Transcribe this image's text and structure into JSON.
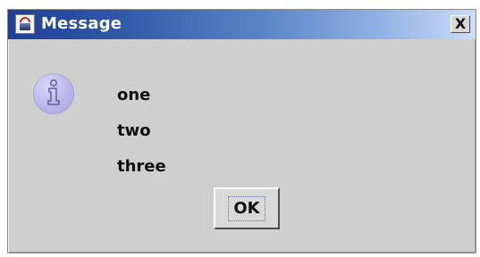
{
  "window": {
    "title": "Message",
    "close_glyph": "X"
  },
  "dialog": {
    "message_lines": [
      "one",
      "two",
      "three"
    ],
    "ok_label": "OK"
  },
  "icons": {
    "app_icon": "java-app-icon",
    "info_icon": "information-icon",
    "close_icon": "close-icon"
  },
  "colors": {
    "title_gradient_start": "#1f3f97",
    "title_gradient_end": "#cbdcf6",
    "dialog_background": "#cfcfcf",
    "info_icon_fill": "#b9b7ea"
  }
}
